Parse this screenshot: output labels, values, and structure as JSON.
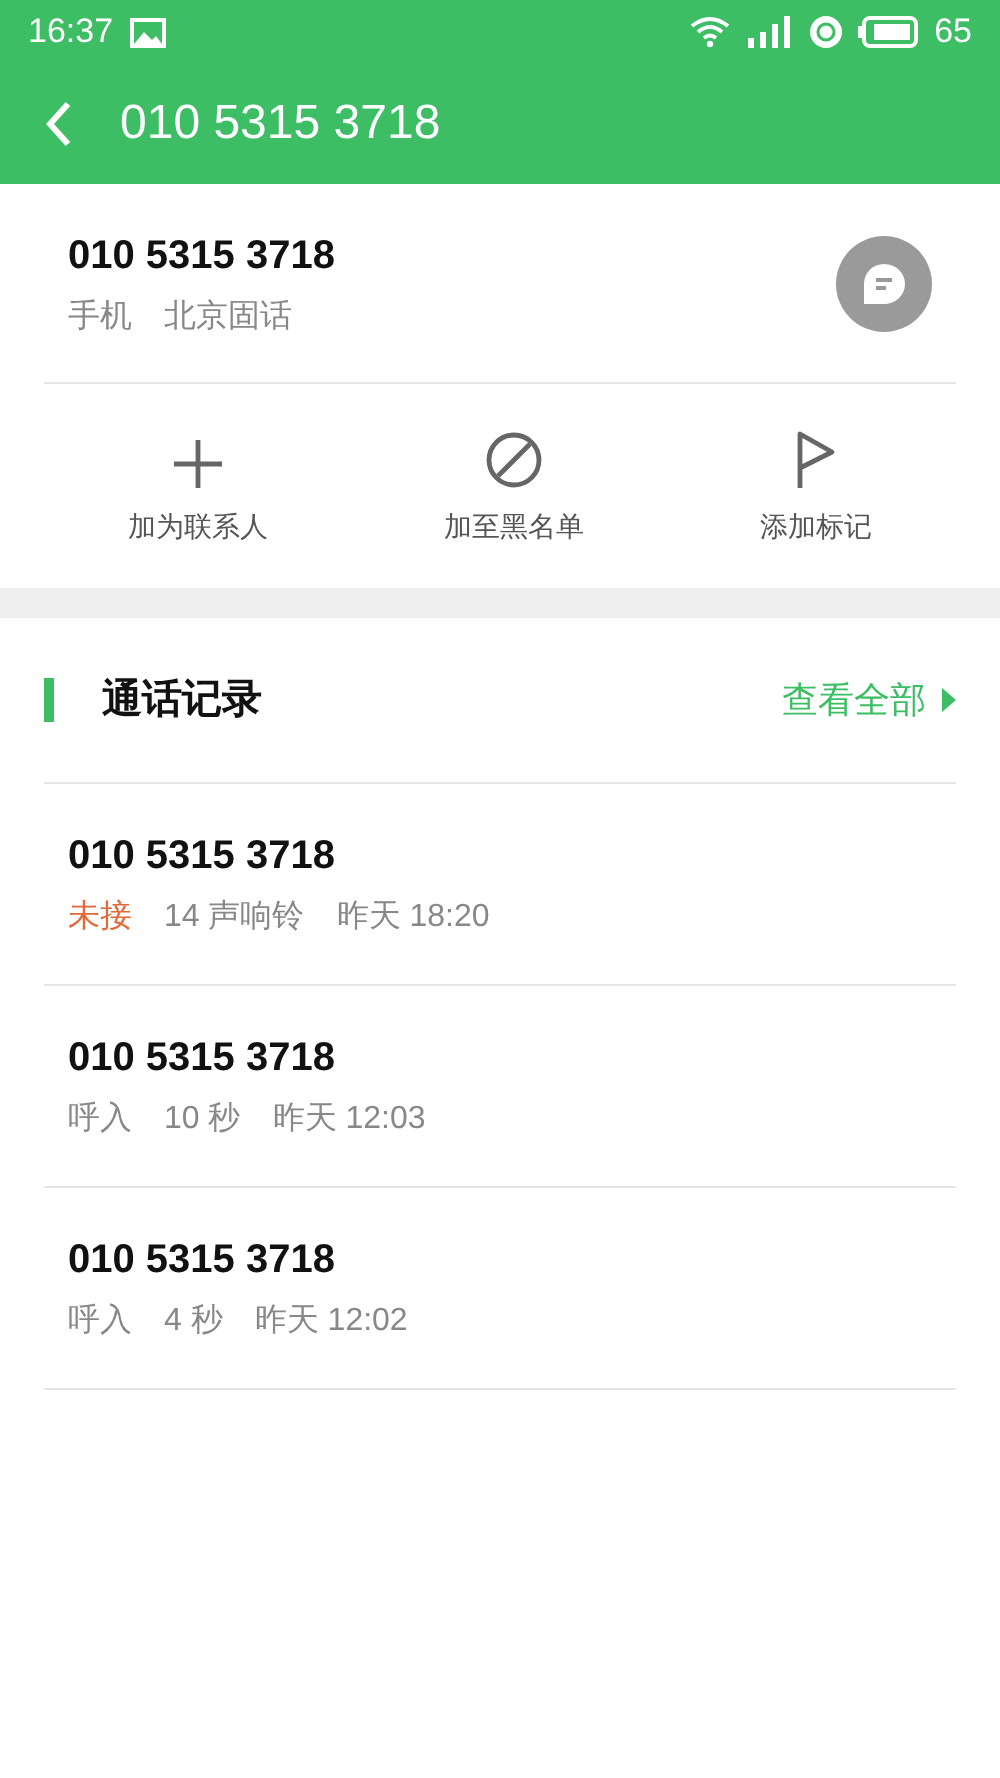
{
  "status_bar": {
    "time": "16:37",
    "battery": "65"
  },
  "header": {
    "title": "010 5315 3718"
  },
  "contact": {
    "number": "010 5315 3718",
    "type": "手机",
    "location": "北京固话"
  },
  "actions": [
    {
      "kind": "add",
      "label": "加为联系人"
    },
    {
      "kind": "block",
      "label": "加至黑名单"
    },
    {
      "kind": "flag",
      "label": "添加标记"
    }
  ],
  "call_log": {
    "title": "通话记录",
    "view_all": "查看全部",
    "calls": [
      {
        "number": "010 5315 3718",
        "kind": "missed",
        "type": "未接",
        "detail": "14 声响铃",
        "time": "昨天 18:20"
      },
      {
        "number": "010 5315 3718",
        "kind": "incoming",
        "type": "呼入",
        "detail": "10 秒",
        "time": "昨天 12:03"
      },
      {
        "number": "010 5315 3718",
        "kind": "incoming",
        "type": "呼入",
        "detail": "4 秒",
        "time": "昨天 12:02"
      }
    ]
  }
}
